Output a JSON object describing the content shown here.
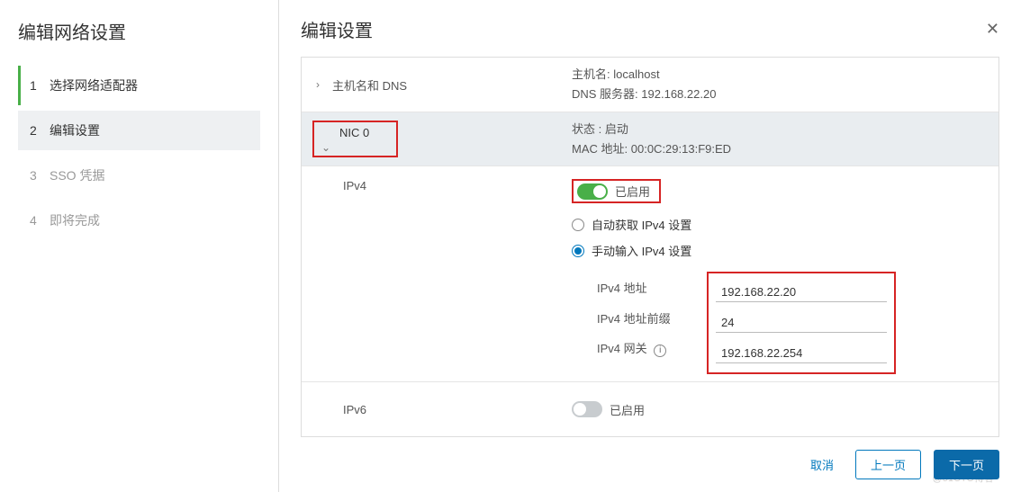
{
  "sidebar": {
    "title": "编辑网络设置",
    "steps": [
      {
        "num": "1",
        "label": "选择网络适配器"
      },
      {
        "num": "2",
        "label": "编辑设置"
      },
      {
        "num": "3",
        "label": "SSO 凭据"
      },
      {
        "num": "4",
        "label": "即将完成"
      }
    ]
  },
  "header": {
    "title": "编辑设置"
  },
  "hostdns": {
    "section_label": "主机名和 DNS",
    "hostname_key": "主机名:",
    "hostname_val": "localhost",
    "dns_key": "DNS 服务器:",
    "dns_val": "192.168.22.20"
  },
  "nic": {
    "name": "NIC 0",
    "state_key": "状态 :",
    "state_val": "启动",
    "mac_key": "MAC 地址:",
    "mac_val": "00:0C:29:13:F9:ED"
  },
  "ipv4": {
    "label": "IPv4",
    "enabled_text": "已启用",
    "auto_label": "自动获取 IPv4 设置",
    "manual_label": "手动输入 IPv4 设置",
    "fields": {
      "addr_label": "IPv4 地址",
      "addr_value": "192.168.22.20",
      "prefix_label": "IPv4 地址前缀",
      "prefix_value": "24",
      "gateway_label": "IPv4 网关",
      "gateway_value": "192.168.22.254"
    }
  },
  "ipv6": {
    "label": "IPv6",
    "enabled_text": "已启用"
  },
  "footer": {
    "cancel": "取消",
    "prev": "上一页",
    "next": "下一页"
  },
  "watermark": "@51CTO博客"
}
